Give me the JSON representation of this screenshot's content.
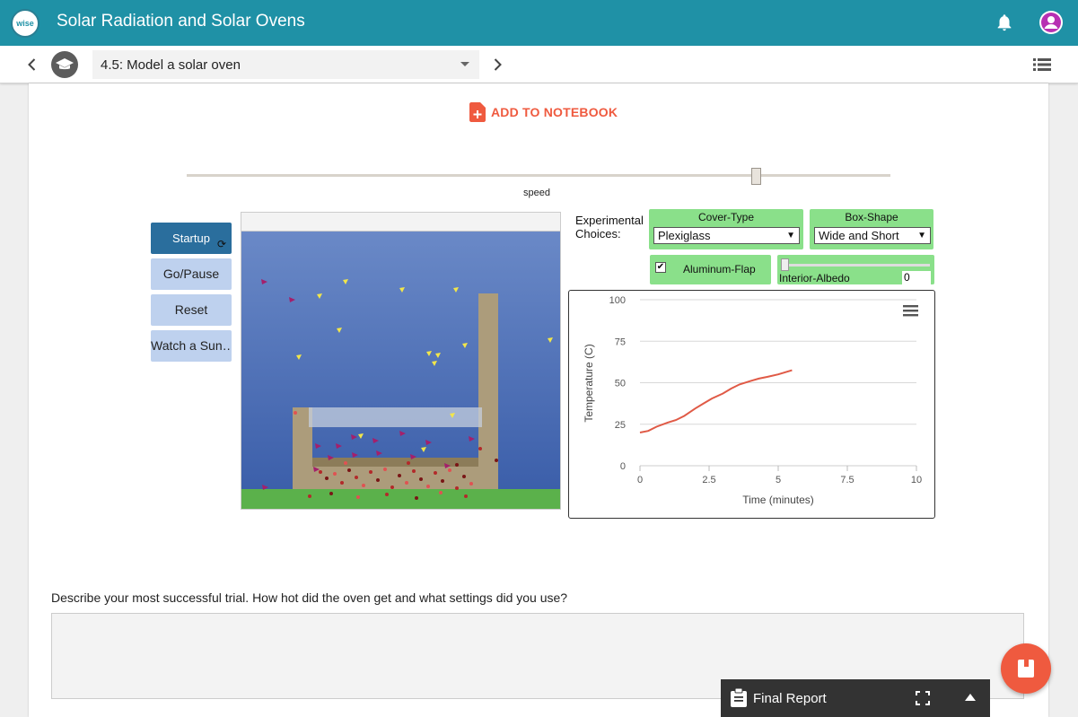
{
  "header": {
    "logo_text": "wise",
    "title": "Solar Radiation and Solar Ovens"
  },
  "nav": {
    "step": "4.5: Model a solar oven"
  },
  "notebook": {
    "label": "ADD TO NOTEBOOK"
  },
  "model": {
    "speed_label": "speed",
    "speed_value": 0.81,
    "buttons": [
      "Startup",
      "Go/Pause",
      "Reset",
      "Watch a Sun…"
    ],
    "experimental_label_1": "Experimental",
    "experimental_label_2": "Choices:",
    "cover_type": {
      "label": "Cover-Type",
      "value": "Plexiglass"
    },
    "box_shape": {
      "label": "Box-Shape",
      "value": "Wide and Short"
    },
    "flap": {
      "label": "Aluminum-Flap",
      "checked": true
    },
    "albedo": {
      "label": "Interior-Albedo",
      "value": "0"
    }
  },
  "chart_data": {
    "type": "line",
    "title": "",
    "xlabel": "Time (minutes)",
    "ylabel": "Temperature (C)",
    "xlim": [
      0,
      10
    ],
    "ylim": [
      0,
      100
    ],
    "x_ticks": [
      "0",
      "2.5",
      "5",
      "7.5",
      "10"
    ],
    "y_ticks": [
      "0",
      "25",
      "50",
      "75",
      "100"
    ],
    "grid": true,
    "color": "#e05a46",
    "x": [
      0,
      0.3,
      0.6,
      1.0,
      1.3,
      1.6,
      2.0,
      2.3,
      2.6,
      3.0,
      3.3,
      3.6,
      4.0,
      4.3,
      4.6,
      5.0,
      5.5
    ],
    "y": [
      20,
      21,
      23.5,
      26,
      27.5,
      30,
      34.5,
      37.5,
      40.5,
      43.5,
      46.5,
      49,
      51,
      52.5,
      53.5,
      55,
      57.5
    ]
  },
  "question": {
    "prompt": "Describe your most successful trial. How hot did the oven get and what settings did you use?"
  },
  "report": {
    "label": "Final Report"
  },
  "colors": {
    "header": "#1f91a6",
    "accent": "#ef5a3f",
    "button": "#bed1ee",
    "button_active": "#2a6e9d",
    "control_green": "#8ae08a"
  }
}
